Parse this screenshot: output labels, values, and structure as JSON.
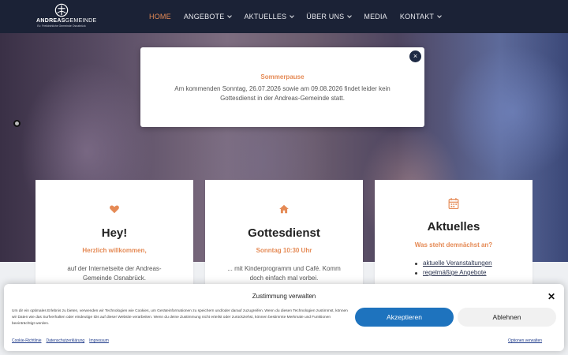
{
  "header": {
    "logo": {
      "name_bold": "ANDREAS",
      "name_thin": "GEMEINDE",
      "tagline": "Ev. Freikirchliche Gemeinde Osnabrück"
    },
    "nav": [
      {
        "label": "HOME",
        "active": true,
        "has_dropdown": false
      },
      {
        "label": "ANGEBOTE",
        "active": false,
        "has_dropdown": true
      },
      {
        "label": "AKTUELLES",
        "active": false,
        "has_dropdown": true
      },
      {
        "label": "ÜBER UNS",
        "active": false,
        "has_dropdown": true
      },
      {
        "label": "MEDIA",
        "active": false,
        "has_dropdown": false
      },
      {
        "label": "KONTAKT",
        "active": false,
        "has_dropdown": true
      }
    ]
  },
  "popup": {
    "title": "Sommerpause",
    "body": "Am kommenden Sonntag, 26.07.2026 sowie am 09.08.2026 findet leider kein Gottesdienst in der Andreas-Gemeinde statt.",
    "close_label": "×"
  },
  "cards": [
    {
      "icon": "heart-icon",
      "title": "Hey!",
      "subtitle": "Herzlich willkommen,",
      "text": "auf der Internetseite der Andreas-Gemeinde Osnabrück."
    },
    {
      "icon": "home-icon",
      "title": "Gottesdienst",
      "subtitle": "Sonntag 10:30 Uhr",
      "text": "... mit Kinderprogramm und Café. Komm doch einfach mal vorbei."
    },
    {
      "icon": "calendar-icon",
      "title": "Aktuelles",
      "subtitle": "Was steht demnächst an?",
      "links": [
        "aktuelle Veranstaltungen",
        "regelmäßige Angebote"
      ]
    }
  ],
  "consent": {
    "title": "Zustimmung verwalten",
    "close_label": "✕",
    "text": "Um dir ein optimales Erlebnis zu bieten, verwenden wir Technologien wie Cookies, um Geräteinformationen zu speichern und/oder darauf zuzugreifen. Wenn du diesen Technologien zustimmst, können wir Daten wie das Surfverhalten oder eindeutige IDs auf dieser Website verarbeiten. Wenn du deine Zustimmung nicht erteilst oder zurückziehst, können bestimmte Merkmale und Funktionen beeinträchtigt werden.",
    "accept_label": "Akzeptieren",
    "decline_label": "Ablehnen",
    "links": [
      "Cookie-Richtlinie",
      "Datenschutzerklärung",
      "Impressum"
    ],
    "options_label": "Optionen verwalten"
  },
  "colors": {
    "accent": "#e58a55",
    "header_bg": "#1b2236",
    "button_blue": "#1e73be"
  }
}
